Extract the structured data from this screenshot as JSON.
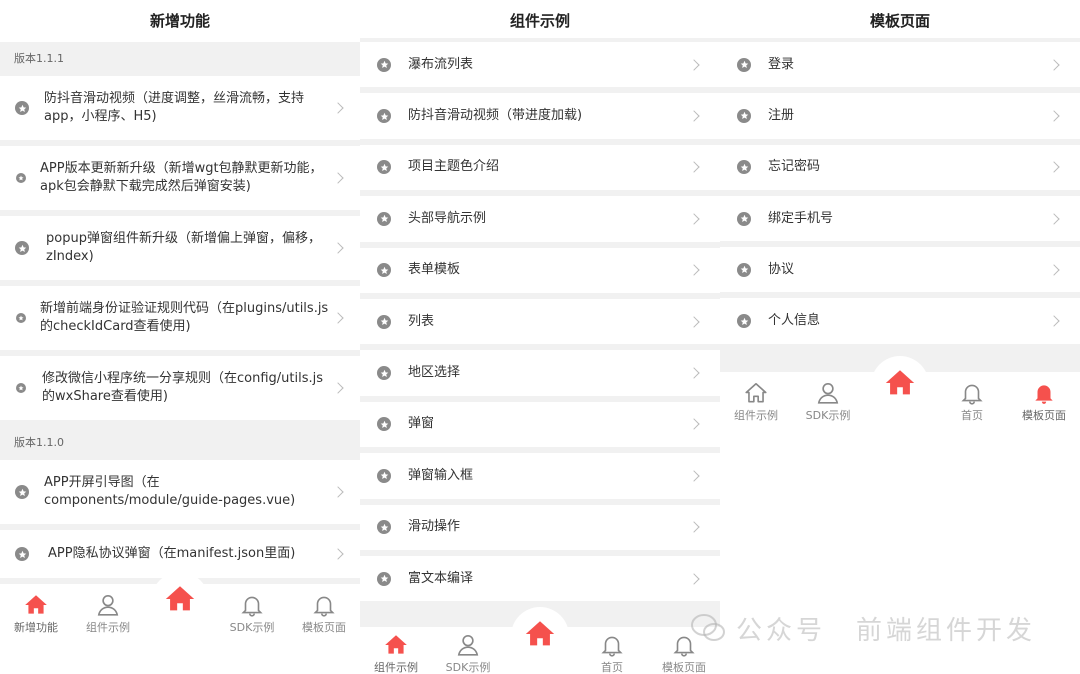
{
  "screen1": {
    "title": "新增功能",
    "sections": [
      {
        "header": "版本1.1.1",
        "items": [
          {
            "label": "防抖音滑动视频（进度调整，丝滑流畅，支持app，小程序、H5)"
          },
          {
            "label": "APP版本更新新升级（新增wgt包静默更新功能，apk包会静默下载完成然后弹窗安装)"
          },
          {
            "label": "popup弹窗组件新升级（新增偏上弹窗，偏移，zIndex)"
          },
          {
            "label": "新增前端身份证验证规则代码（在plugins/utils.js的checkIdCard查看使用)"
          },
          {
            "label": "修改微信小程序统一分享规则（在config/utils.js的wxShare查看使用)"
          }
        ]
      },
      {
        "header": "版本1.1.0",
        "items": [
          {
            "label": "APP开屏引导图（在components/module/guide-pages.vue)"
          },
          {
            "label": "APP隐私协议弹窗（在manifest.json里面)"
          }
        ]
      }
    ],
    "tabbar": [
      {
        "label": "新增功能",
        "icon": "home-icon",
        "active": true
      },
      {
        "label": "组件示例",
        "icon": "user-icon",
        "active": false
      },
      {
        "label": "",
        "icon": "home-icon",
        "center": true
      },
      {
        "label": "SDK示例",
        "icon": "bell-icon",
        "active": false
      },
      {
        "label": "模板页面",
        "icon": "bell-icon",
        "active": false
      }
    ]
  },
  "screen2": {
    "title": "组件示例",
    "items": [
      {
        "label": "瀑布流列表"
      },
      {
        "label": "防抖音滑动视频（带进度加载)"
      },
      {
        "label": "项目主题色介绍"
      },
      {
        "label": "头部导航示例"
      },
      {
        "label": "表单模板"
      },
      {
        "label": "列表"
      },
      {
        "label": "地区选择"
      },
      {
        "label": "弹窗"
      },
      {
        "label": "弹窗输入框"
      },
      {
        "label": "滑动操作"
      },
      {
        "label": "富文本编译"
      }
    ],
    "tabbar": [
      {
        "label": "组件示例",
        "icon": "home-icon",
        "active": true
      },
      {
        "label": "SDK示例",
        "icon": "user-icon",
        "active": false
      },
      {
        "label": "",
        "icon": "home-icon",
        "center": true
      },
      {
        "label": "首页",
        "icon": "bell-icon",
        "active": false
      },
      {
        "label": "模板页面",
        "icon": "bell-icon",
        "active": false
      }
    ]
  },
  "screen3": {
    "title": "模板页面",
    "items": [
      {
        "label": "登录"
      },
      {
        "label": "注册"
      },
      {
        "label": "忘记密码"
      },
      {
        "label": "绑定手机号"
      },
      {
        "label": "协议"
      },
      {
        "label": "个人信息"
      }
    ],
    "tabbar": [
      {
        "label": "组件示例",
        "icon": "home-icon",
        "active": false
      },
      {
        "label": "SDK示例",
        "icon": "user-icon",
        "active": false
      },
      {
        "label": "",
        "icon": "home-icon",
        "center": true
      },
      {
        "label": "首页",
        "icon": "bell-icon",
        "active": false
      },
      {
        "label": "模板页面",
        "icon": "bell-icon",
        "active": true
      }
    ]
  },
  "watermark": {
    "left": "公众号",
    "right": "前端组件开发"
  },
  "colors": {
    "accent": "#f5514d",
    "icon_gray": "#8a8a8a",
    "divider": "#f1f1f1",
    "text": "#333333"
  }
}
